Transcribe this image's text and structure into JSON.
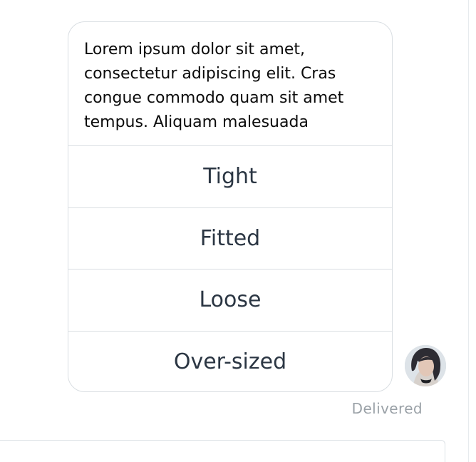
{
  "message": {
    "text": "Lorem ipsum dolor sit amet,\nconsectetur adipiscing elit. Cras\ncongue commodo quam sit amet\ntempus. Aliquam malesuada"
  },
  "quick_replies": [
    {
      "label": "Tight"
    },
    {
      "label": "Fitted"
    },
    {
      "label": "Loose"
    },
    {
      "label": "Over-sized"
    }
  ],
  "status": {
    "text": "Delivered"
  },
  "colors": {
    "text": "#0b0b0b",
    "option_text": "#2b3643",
    "border": "#d9dee2",
    "status": "#9aa1a7"
  }
}
